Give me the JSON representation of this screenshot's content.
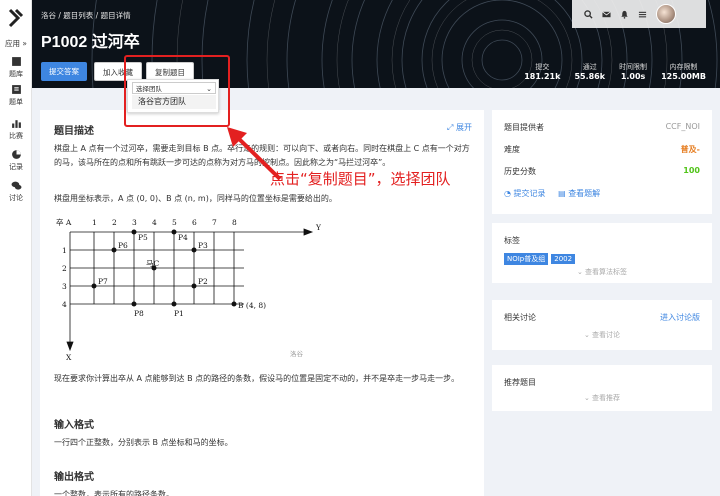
{
  "nav": {
    "app_label": "应用 »",
    "items": [
      {
        "label": "题库"
      },
      {
        "label": "题单"
      },
      {
        "label": "比赛"
      },
      {
        "label": "记录"
      },
      {
        "label": "讨论"
      }
    ]
  },
  "banner": {
    "breadcrumb": "洛谷 / 题目列表 / 题目详情",
    "title": "P1002 过河卒",
    "buttons": {
      "submit": "提交答案",
      "favorite": "加入收藏",
      "copy": "复制题目"
    },
    "stats": [
      {
        "k": "提交",
        "v": "181.21k"
      },
      {
        "k": "通过",
        "v": "55.86k"
      },
      {
        "k": "时间限制",
        "v": "1.00s"
      },
      {
        "k": "内存限制",
        "v": "125.00MB"
      }
    ]
  },
  "popup": {
    "select_label": "选择团队",
    "option": "洛谷官方团队"
  },
  "annotation": "点击“复制题目”，选择团队",
  "problem": {
    "section_title": "题目描述",
    "expand": "展开",
    "desc_1": "棋盘上 A 点有一个过河卒，需要走到目标 B 点。卒行走的规则：可以向下、或者向右。同时在棋盘上 C 点有一个对方的马，该马所在的点和所有跳跃一步可达的点称为对方马的控制点。因此称之为“马拦过河卒”。",
    "desc_2": "棋盘用坐标表示，A 点 (0, 0)、B 点 (n, m)，同样马的位置坐标是需要给出的。",
    "figure_caption": "洛谷",
    "desc_3": "现在要求你计算出卒从 A 点能够到达 B 点的路径的条数，假设马的位置是固定不动的，并不是卒走一步马走一步。",
    "input_title": "输入格式",
    "input_desc": "一行四个正整数，分别表示 B 点坐标和马的坐标。",
    "output_title": "输出格式",
    "output_desc": "一个整数，表示所有的路径条数。"
  },
  "info": {
    "provider_label": "题目提供者",
    "provider": "CCF_NOI",
    "difficulty_label": "难度",
    "difficulty": "普及-",
    "score_label": "历史分数",
    "score": "100",
    "records": "提交记录",
    "solutions": "查看题解"
  },
  "tags_card": {
    "title": "标签",
    "tags": [
      "NOIp普及组",
      "2002"
    ],
    "more": "查看算法标签"
  },
  "discuss_card": {
    "title": "相关讨论",
    "link": "进入讨论版",
    "more": "查看讨论"
  },
  "recommend_card": {
    "title": "推荐题目",
    "more": "查看推荐"
  },
  "figure": {
    "corner": "卒 A",
    "cols": [
      "1",
      "2",
      "3",
      "4",
      "5",
      "6",
      "7",
      "8"
    ],
    "rows": [
      "1",
      "2",
      "3",
      "4"
    ],
    "y_axis": "Y",
    "x_axis": "X",
    "points": [
      "P6",
      "P5",
      "P4",
      "P3",
      "马C",
      "P7",
      "P2",
      "P8",
      "P1",
      "B (4, 8)"
    ]
  },
  "colors": {
    "accent": "#3e86e1",
    "red": "#e32020",
    "orange": "#e67e22",
    "green": "#52c41a"
  }
}
